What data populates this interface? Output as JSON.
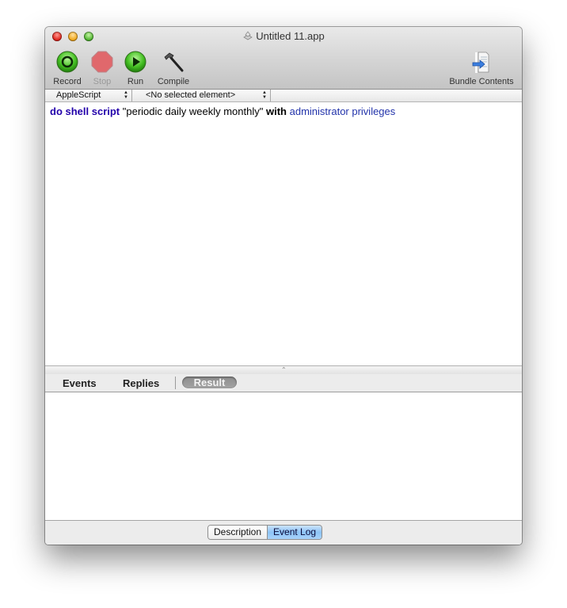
{
  "window": {
    "title": "Untitled 11.app",
    "title_icon": "applescript-document-icon"
  },
  "toolbar": {
    "record_label": "Record",
    "stop_label": "Stop",
    "run_label": "Run",
    "compile_label": "Compile",
    "bundle_label": "Bundle Contents"
  },
  "navbar": {
    "language": "AppleScript",
    "element": "<No selected element>"
  },
  "editor": {
    "tokens": {
      "t1": "do shell script",
      "t2": " ",
      "t3": "\"periodic daily weekly monthly\"",
      "t4": " ",
      "t5": "with",
      "t6": " ",
      "t7": "administrator privileges"
    }
  },
  "log": {
    "tabs": [
      "Events",
      "Replies",
      "Result"
    ],
    "selected_tab": "Result"
  },
  "bottom": {
    "segments": [
      "Description",
      "Event Log"
    ],
    "selected": "Event Log"
  },
  "colors": {
    "keyword": "#2200aa",
    "parameter": "#2233aa",
    "segment_active": "#8cc3f6"
  }
}
